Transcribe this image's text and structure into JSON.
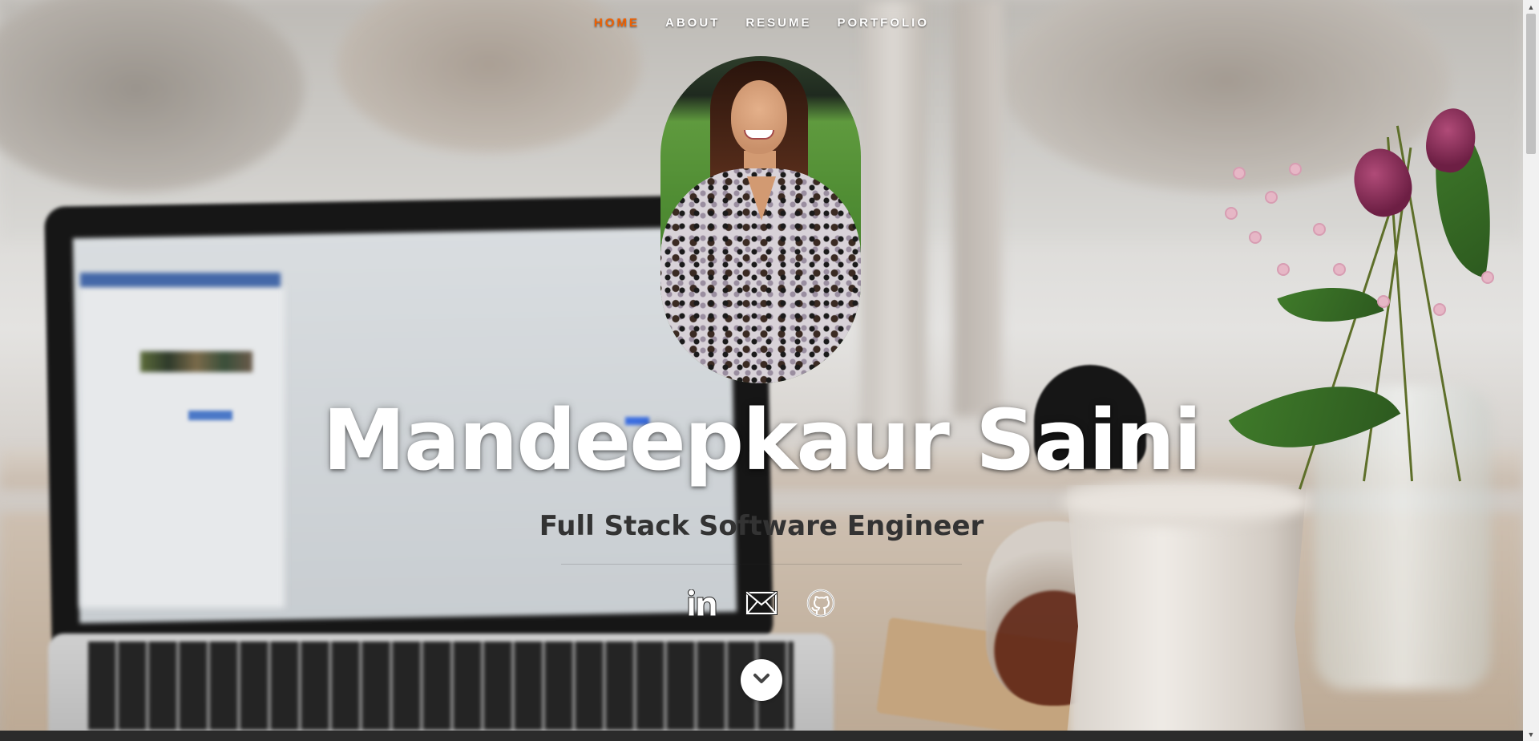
{
  "nav": {
    "items": [
      {
        "label": "HOME",
        "current": true
      },
      {
        "label": "ABOUT",
        "current": false
      },
      {
        "label": "RESUME",
        "current": false
      },
      {
        "label": "PORTFOLIO",
        "current": false
      }
    ]
  },
  "banner": {
    "name": "Mandeepkaur Saini",
    "role": "Full Stack Software Engineer",
    "profile_photo": "profile-photo"
  },
  "social": [
    {
      "icon": "linkedin-icon"
    },
    {
      "icon": "mail-icon"
    },
    {
      "icon": "github-icon"
    }
  ],
  "scroll_down": {
    "icon": "chevron-down-icon"
  },
  "colors": {
    "nav_current": "#f06000",
    "nav_text": "#ffffff",
    "name_text": "#ffffff",
    "role_text": "#333333",
    "bottom_bar": "#2b2b2b"
  }
}
